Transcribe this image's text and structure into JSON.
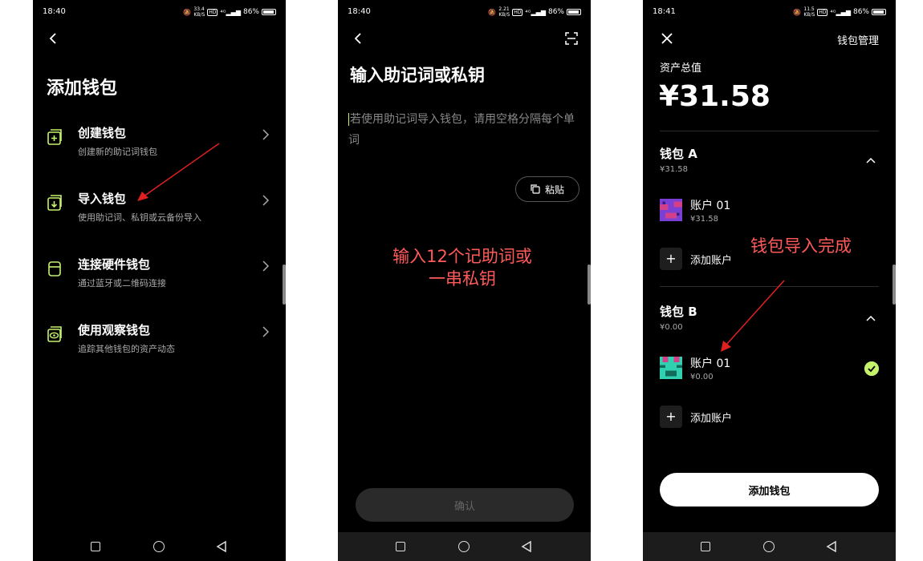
{
  "colors": {
    "accent": "#c6f36b",
    "annotation": "#ff5a5a",
    "background": "#000000"
  },
  "panel1": {
    "status": {
      "time": "18:40",
      "speed": "33.4\nKB/S",
      "battery": "86%"
    },
    "back_icon": "back-arrow-icon",
    "title": "添加钱包",
    "items": [
      {
        "icon": "create-wallet-icon",
        "title": "创建钱包",
        "sub": "创建新的助记词钱包"
      },
      {
        "icon": "import-wallet-icon",
        "title": "导入钱包",
        "sub": "使用助记词、私钥或云备份导入"
      },
      {
        "icon": "hardware-wallet-icon",
        "title": "连接硬件钱包",
        "sub": "通过蓝牙或二维码连接"
      },
      {
        "icon": "watch-wallet-icon",
        "title": "使用观察钱包",
        "sub": "追踪其他钱包的资产动态"
      }
    ]
  },
  "panel2": {
    "status": {
      "time": "18:40",
      "speed": "2.21\nKB/S",
      "battery": "86%"
    },
    "title": "输入助记词或私钥",
    "placeholder": "若使用助记词导入钱包，请用空格分隔每个单词",
    "paste_label": "粘贴",
    "confirm_label": "确认",
    "annotation": "输入12个记助词或\n一串私钥"
  },
  "panel3": {
    "status": {
      "time": "18:41",
      "speed": "11.5\nKB/S",
      "battery": "86%"
    },
    "header_right": "钱包管理",
    "total_label": "资产总值",
    "total_value": "¥31.58",
    "wallets": [
      {
        "name": "钱包 A",
        "balance": "¥31.58",
        "account": {
          "name": "账户 01",
          "balance": "¥31.58"
        },
        "add_label": "添加账户"
      },
      {
        "name": "钱包 B",
        "balance": "¥0.00",
        "account": {
          "name": "账户 01",
          "balance": "¥0.00"
        },
        "add_label": "添加账户"
      }
    ],
    "add_wallet_label": "添加钱包",
    "annotation": "钱包导入完成"
  }
}
